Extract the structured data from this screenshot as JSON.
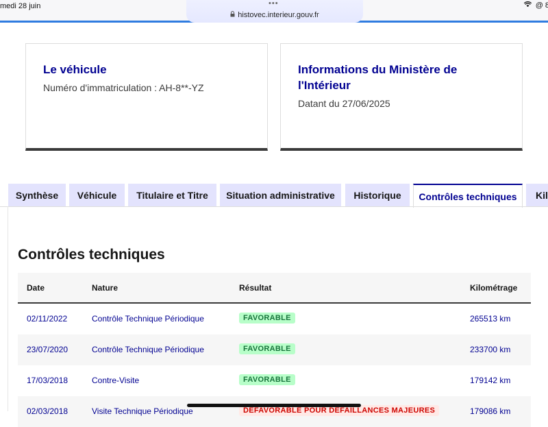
{
  "statusbar": {
    "date": "medi 28 juin",
    "dots": "•••",
    "url": "histovec.interieur.gouv.fr",
    "right_icons": [
      "wifi-icon",
      "at-icon"
    ],
    "right_text": "8"
  },
  "cards": {
    "vehicle": {
      "title": "Le véhicule",
      "subtitle": "Numéro d'immatriculation : AH-8**-YZ"
    },
    "ministry": {
      "title": "Informations du Ministère de l'Intérieur",
      "subtitle": "Datant du 27/06/2025"
    }
  },
  "tabs": [
    {
      "label": "Synthèse"
    },
    {
      "label": "Véhicule"
    },
    {
      "label": "Titulaire et Titre"
    },
    {
      "label": "Situation administrative"
    },
    {
      "label": "Historique"
    },
    {
      "label": "Contrôles techniques"
    },
    {
      "label": "Kilo"
    }
  ],
  "active_tab": "Contrôles techniques",
  "section": {
    "title": "Contrôles techniques"
  },
  "table": {
    "headers": [
      "Date",
      "Nature",
      "Résultat",
      "Kilométrage"
    ],
    "rows": [
      {
        "date": "02/11/2022",
        "nature": "Contrôle Technique Périodique",
        "result": "FAVORABLE",
        "km": "265513 km"
      },
      {
        "date": "23/07/2020",
        "nature": "Contrôle Technique Périodique",
        "result": "FAVORABLE",
        "km": "233700 km"
      },
      {
        "date": "17/03/2018",
        "nature": "Contre-Visite",
        "result": "FAVORABLE",
        "km": "179142 km"
      },
      {
        "date": "02/03/2018",
        "nature": "Visite Technique Périodique",
        "result": "DÉFAVORABLE POUR DÉFAILLANCES MAJEURES",
        "km": "179086 km"
      }
    ]
  },
  "colors": {
    "accent": "#000091",
    "tab_bg": "#e3e3fd",
    "success_bg": "#b8fec9",
    "success_text": "#18753c",
    "error_bg": "#ffe9e6",
    "error_text": "#ce0500"
  }
}
